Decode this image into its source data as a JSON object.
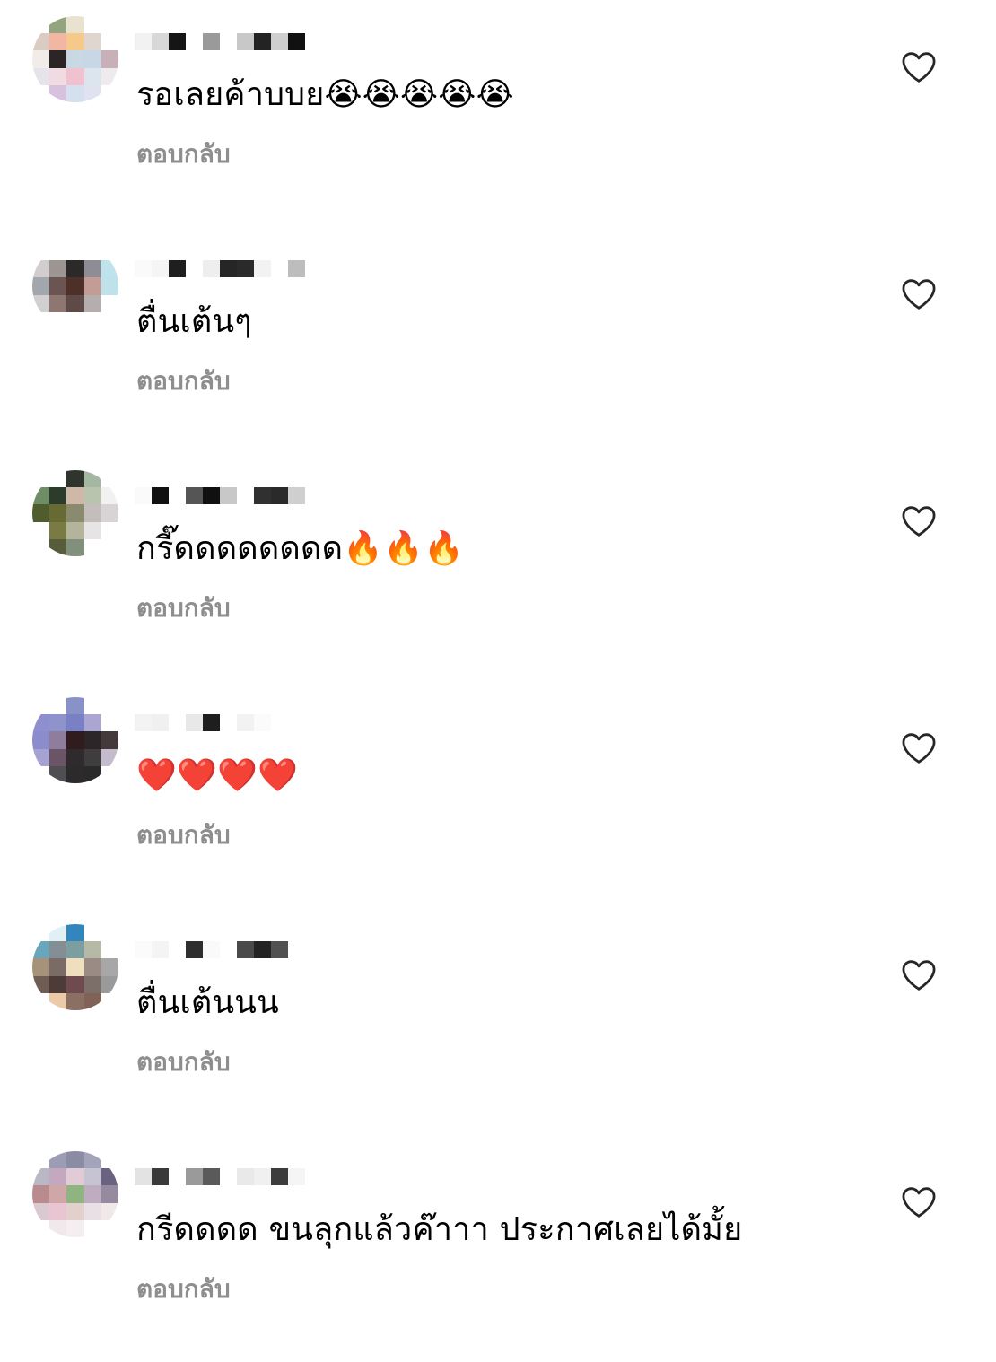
{
  "comments": [
    {
      "text": "รอเลยค้าบบย😭😭😭😭😭",
      "reply_label": "ตอบกลับ",
      "avatar_pixels": [
        "#ffffff",
        "#93a57f",
        "#e8e2cf",
        "#ffffff",
        "#ffffff",
        "#dccbc3",
        "#f2b7a2",
        "#f4c98a",
        "#dfd7cf",
        "#ffffff",
        "#f1ece8",
        "#2b2625",
        "#c8d9e4",
        "#c7d7e6",
        "#c8b0b9",
        "#e6e4ea",
        "#f1dae1",
        "#f0c1cf",
        "#dce4ee",
        "#efeaee",
        "#ffffff",
        "#d8c1df",
        "#d4e0ee",
        "#e0e3ef",
        "#ffffff"
      ],
      "username_pixels": [
        "#f2f2f2",
        "#d8d8d8",
        "#151515",
        "#ffffff",
        "#9a9a9a",
        "#ffffff",
        "#c8c8c8",
        "#232323",
        "#cfcfcf",
        "#111111"
      ]
    },
    {
      "text": "ตื่นเต้นๆ",
      "reply_label": "ตอบกลับ",
      "avatar_pixels": [
        "#ffffff",
        "#ffffff",
        "#ffffff",
        "#ffffff",
        "#ffffff",
        "#d1cecd",
        "#9c9592",
        "#2b2a29",
        "#8e8d95",
        "#bfe3ec",
        "#a2a7ad",
        "#6b5552",
        "#4d3027",
        "#c39d95",
        "#bfe2ea",
        "#d1cfcf",
        "#8f7771",
        "#5e4a46",
        "#b5aeae",
        "#ffffff",
        "#ffffff",
        "#ffffff",
        "#ffffff",
        "#ffffff",
        "#ffffff"
      ],
      "username_pixels": [
        "#fafafa",
        "#f5f5f5",
        "#1f1f1f",
        "#ffffff",
        "#eeeeee",
        "#262626",
        "#2a2a2a",
        "#f2f2f2",
        "#ffffff",
        "#bdbdbd"
      ]
    },
    {
      "text": "กรี๊ดดดดดดดด🔥🔥🔥",
      "reply_label": "ตอบกลับ",
      "avatar_pixels": [
        "#ffffff",
        "#ffffff",
        "#2f342c",
        "#a3b7a1",
        "#ffffff",
        "#6f8e68",
        "#2d3b2b",
        "#d0b8a8",
        "#b8c4ad",
        "#f1f1f1",
        "#4f5c2e",
        "#676a33",
        "#8a8a6f",
        "#c5bdbc",
        "#d8d4d6",
        "#ffffff",
        "#7a7a45",
        "#b4b49c",
        "#e6e4e4",
        "#ffffff",
        "#ffffff",
        "#575c3a",
        "#80907a",
        "#ffffff",
        "#ffffff"
      ],
      "username_pixels": [
        "#fafafa",
        "#111111",
        "#ffffff",
        "#555555",
        "#101010",
        "#c8c8c8",
        "#ffffff",
        "#303030",
        "#2a2a2a",
        "#cfcfcf"
      ]
    },
    {
      "text": "❤️❤️❤️❤️",
      "reply_label": "ตอบกลับ",
      "avatar_pixels": [
        "#ffffff",
        "#ffffff",
        "#8892c8",
        "#ffffff",
        "#ffffff",
        "#8f8fcf",
        "#8e94cb",
        "#7a80c4",
        "#aaa6d1",
        "#ffffff",
        "#8a8ccc",
        "#8e7d9c",
        "#301c1f",
        "#2c2628",
        "#44393b",
        "#a4a3d1",
        "#6a5567",
        "#2f2a2d",
        "#403d3f",
        "#c4bccd",
        "#ffffff",
        "#4f4e52",
        "#2d2a2b",
        "#2a2a2b",
        "#ffffff"
      ],
      "username_pixels": [
        "#f3f3f3",
        "#f0f0f0",
        "#ffffff",
        "#e8e8e8",
        "#1e1e1e",
        "#ffffff",
        "#f2f2f2",
        "#fbfbfb",
        "#ffffff",
        "#ffffff"
      ]
    },
    {
      "text": "ตื่นเต้นนน",
      "reply_label": "ตอบกลับ",
      "avatar_pixels": [
        "#ffffff",
        "#e0f0f5",
        "#3286bb",
        "#ffffff",
        "#ffffff",
        "#6aa6bb",
        "#838f95",
        "#7c9e9e",
        "#b5b9a5",
        "#ffffff",
        "#a6927a",
        "#7a6b66",
        "#f0dfbf",
        "#9a8c85",
        "#a7a7a7",
        "#6f5c53",
        "#4d3b37",
        "#6f4a4e",
        "#7c6f69",
        "#9a9a9a",
        "#ffffff",
        "#eccaa7",
        "#8a6f63",
        "#806256",
        "#ffffff"
      ],
      "username_pixels": [
        "#fbfbfb",
        "#f4f4f4",
        "#ffffff",
        "#2e2e2e",
        "#fafafa",
        "#ffffff",
        "#4a4a4a",
        "#232323",
        "#515151",
        "#ffffff"
      ]
    },
    {
      "text": "กรีดดดด ขนลุกแล้วค๊าาา ประกาศเลยได้มั้ย",
      "reply_label": "ตอบกลับ",
      "avatar_pixels": [
        "#ffffff",
        "#9c9db5",
        "#8b8ca4",
        "#a3a3ba",
        "#ffffff",
        "#bbb8c6",
        "#c4a8bf",
        "#e1cbd6",
        "#c6c4d2",
        "#6b6180",
        "#b98a8e",
        "#d0a7a7",
        "#8fb480",
        "#bfacc0",
        "#968aa0",
        "#dac9d1",
        "#e9c5d2",
        "#e2d0cc",
        "#e8e0e4",
        "#f1e8ea",
        "#ffffff",
        "#f1e8ec",
        "#f5eef1",
        "#ffffff",
        "#ffffff"
      ],
      "username_pixels": [
        "#e3e3e3",
        "#3a3a3a",
        "#ffffff",
        "#9a9a9a",
        "#5a5a5a",
        "#ffffff",
        "#e9e9e9",
        "#f0f0f0",
        "#3c3c3c",
        "#f5f5f5"
      ]
    }
  ],
  "colors": {
    "reply_text": "#8e8e8e",
    "like_icon_stroke": "#262626",
    "background": "#ffffff"
  },
  "icons": {
    "like": "heart-outline-icon"
  }
}
